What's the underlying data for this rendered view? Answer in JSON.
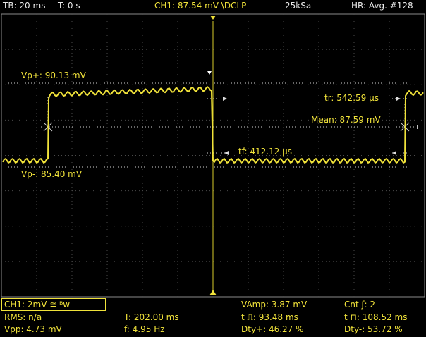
{
  "header": {
    "timebase": "TB: 20 ms",
    "trigger_time": "T: 0 s",
    "channel": "CH1: 87.54 mV \\DCLP",
    "sample_rate": "25kSa",
    "acq_mode": "HR: Avg. #128"
  },
  "cursors": {
    "vp_plus": "Vp+: 90.13 mV",
    "vp_minus": "Vp-: 85.40 mV",
    "mean": "Mean: 87.59 mV",
    "rise": "tr: 542.59 µs",
    "fall": "tf: 412.12 µs",
    "edge_marker": "T"
  },
  "footer": {
    "ch_setting": "CH1: 2mV ≅ ᴮw",
    "rms": "RMS: n/a",
    "vpp": "Vpp: 4.73 mV",
    "period": "T: 202.00 ms",
    "freq": "f: 4.95 Hz",
    "vamp": "VAmp: 3.87 mV",
    "pos_width": "t ⎍: 93.48 ms",
    "dty_pos": "Dty+: 46.27 %",
    "count": "Cnt ʃ: 2",
    "neg_width": "t ⊓: 108.52 ms",
    "dty_neg": "Dty-: 53.72 %"
  },
  "colors": {
    "trace": "#f0e23a",
    "grid": "#555555",
    "text": "#e8e8e8"
  }
}
